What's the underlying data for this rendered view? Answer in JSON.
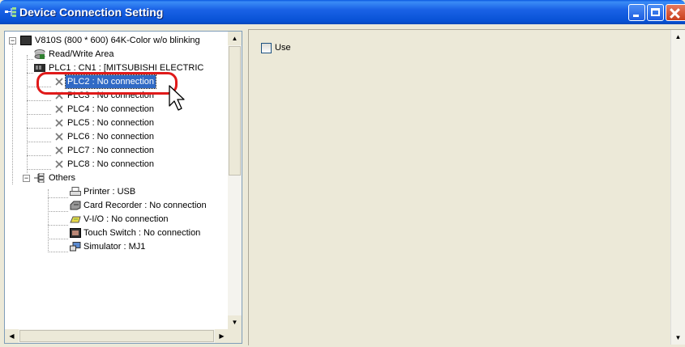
{
  "window": {
    "title": "Device Connection Setting",
    "icon": "device-connection-icon"
  },
  "tree": {
    "root": "V810S (800 * 600) 64K-Color w/o blinking",
    "items": [
      {
        "label": "Read/Write Area",
        "icon": "database-icon"
      },
      {
        "label": "PLC1 : CN1 : [MITSUBISHI ELECTRIC",
        "icon": "plc-icon"
      },
      {
        "label": "PLC2 : No connection",
        "icon": "x-icon",
        "selected": true
      },
      {
        "label": "PLC3 : No connection",
        "icon": "x-icon"
      },
      {
        "label": "PLC4 : No connection",
        "icon": "x-icon"
      },
      {
        "label": "PLC5 : No connection",
        "icon": "x-icon"
      },
      {
        "label": "PLC6 : No connection",
        "icon": "x-icon"
      },
      {
        "label": "PLC7 : No connection",
        "icon": "x-icon"
      },
      {
        "label": "PLC8 : No connection",
        "icon": "x-icon"
      }
    ],
    "others": {
      "label": "Others",
      "items": [
        {
          "label": "Printer : USB",
          "icon": "printer-icon"
        },
        {
          "label": "Card Recorder : No connection",
          "icon": "card-recorder-icon"
        },
        {
          "label": "V-I/O : No connection",
          "icon": "vio-icon"
        },
        {
          "label": "Touch Switch : No connection",
          "icon": "touch-switch-icon"
        },
        {
          "label": "Simulator : MJ1",
          "icon": "simulator-icon"
        }
      ]
    }
  },
  "settings": {
    "use_label": "Use",
    "use_checked": false
  },
  "colors": {
    "selection": "#316ac5",
    "highlight": "#e01a1a",
    "title_bar": "#0751d4"
  }
}
